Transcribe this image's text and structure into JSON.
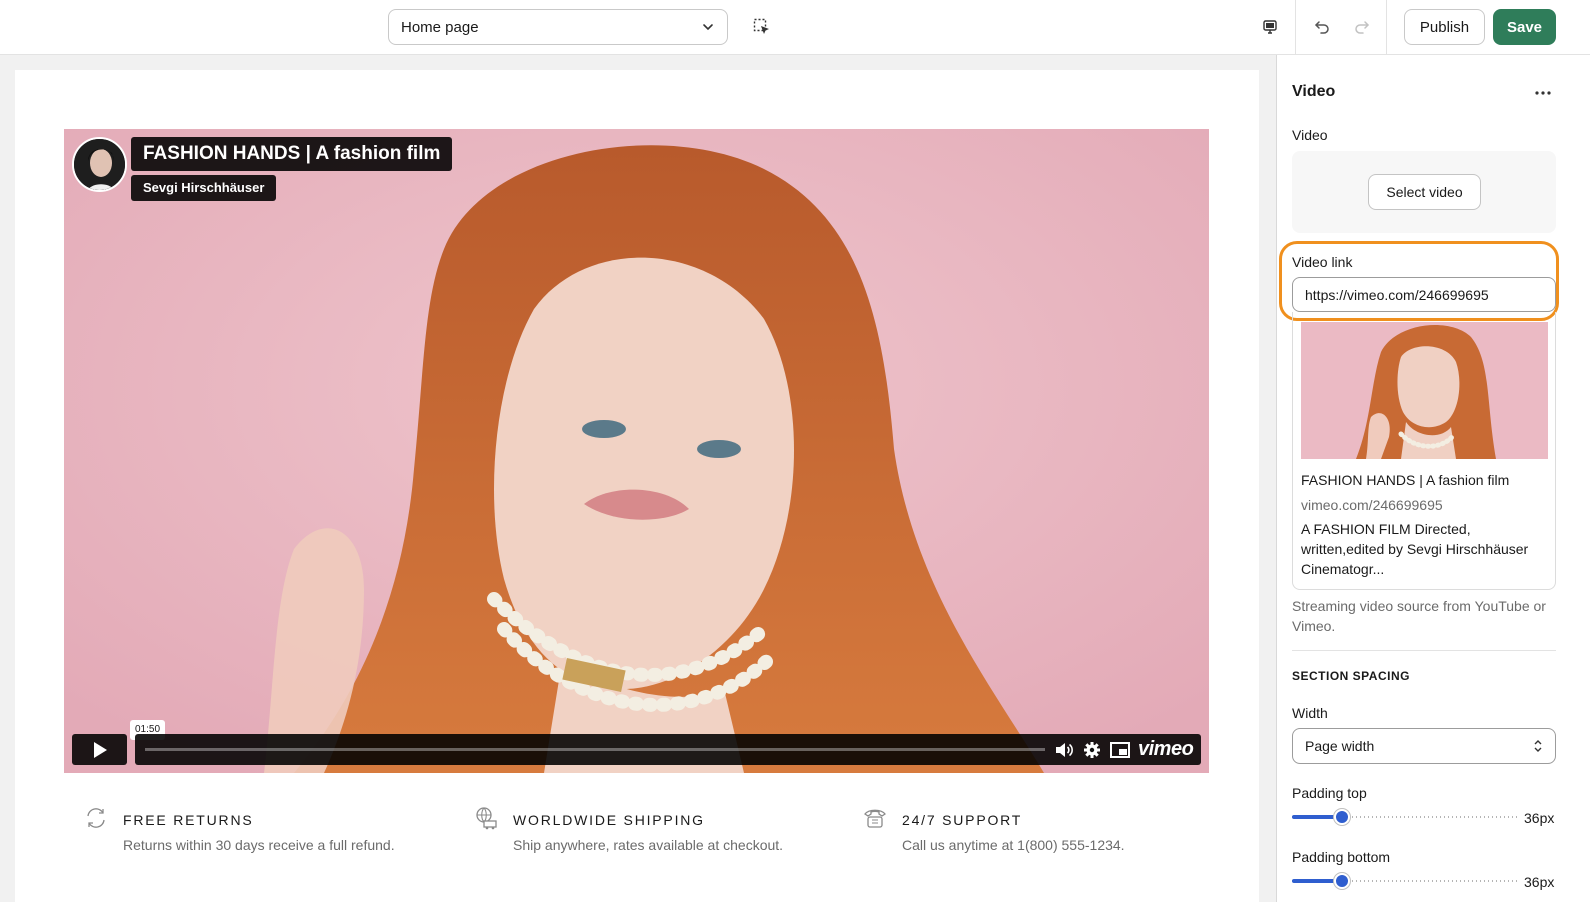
{
  "topbar": {
    "page_select": "Home page",
    "publish_label": "Publish",
    "save_label": "Save",
    "save_color": "#2f7d5a"
  },
  "video": {
    "title": "FASHION HANDS | A fashion film",
    "author": "Sevgi Hirschhäuser",
    "current_time": "01:50",
    "provider_logo": "vimeo",
    "icons": [
      "play-icon",
      "volume-icon",
      "settings-icon",
      "pip-icon"
    ]
  },
  "features": [
    {
      "icon": "returns-icon",
      "title": "FREE RETURNS",
      "desc": "Returns within 30 days receive a full refund."
    },
    {
      "icon": "shipping-icon",
      "title": "WORLDWIDE SHIPPING",
      "desc": "Ship anywhere, rates available at checkout."
    },
    {
      "icon": "phone-icon",
      "title": "24/7 SUPPORT",
      "desc": "Call us anytime at 1(800) 555-1234."
    }
  ],
  "sidebar": {
    "title": "Video",
    "video_label": "Video",
    "select_video_label": "Select video",
    "video_link_label": "Video link",
    "video_link_value": "https://vimeo.com/246699695",
    "card": {
      "title": "FASHION HANDS | A fashion film",
      "url": "vimeo.com/246699695",
      "description": "A FASHION FILM Directed, written,edited by Sevgi Hirschhäuser Cinematogr..."
    },
    "help_text": "Streaming video source from YouTube or Vimeo.",
    "section_spacing": "SECTION SPACING",
    "width_label": "Width",
    "width_value": "Page width",
    "padding_top_label": "Padding top",
    "padding_top_value": "36px",
    "padding_top_fraction": 0.22,
    "padding_bottom_label": "Padding bottom",
    "padding_bottom_value": "36px",
    "padding_bottom_fraction": 0.22,
    "highlight_color": "#f0901e",
    "accent_color": "#2f5ecf"
  }
}
